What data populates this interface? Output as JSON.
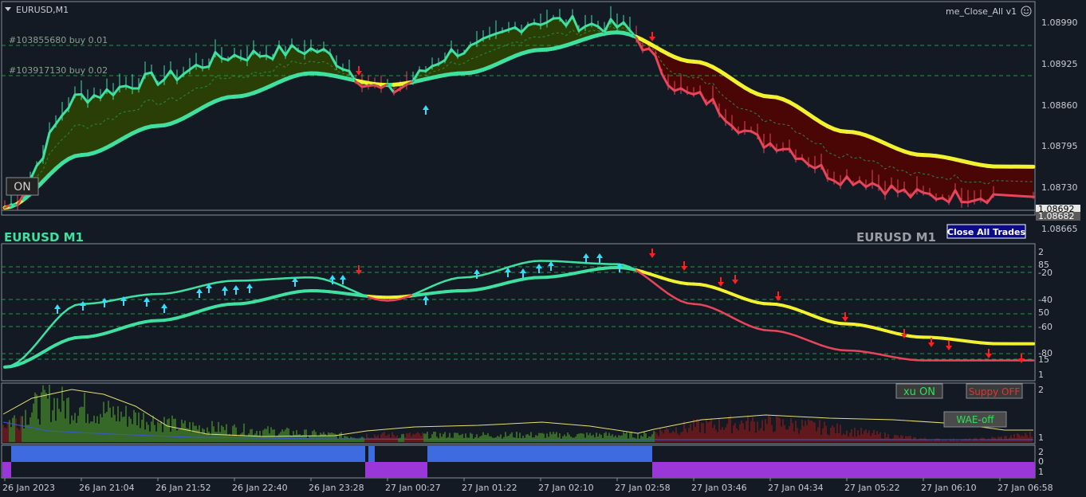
{
  "colors": {
    "background": "#131a24",
    "grid_dash": "#1f9a3f",
    "bull": "#3fe0a0",
    "bear": "#e8445a",
    "slow": "#f2f230",
    "ribbon_bull": "#2a3f06",
    "ribbon_bear": "#4a0505",
    "panel_border": "#8a8f96",
    "volume_bull": "#5ab52a",
    "volume_bear": "#b01818",
    "signal_line": "#e8e070",
    "strip_blue": "#3e6be0",
    "strip_purple": "#9b36d8"
  },
  "header": {
    "symbol": "EURUSD,M1",
    "indicator": "me_Close_All v1",
    "smiley_icon": "smiley-icon"
  },
  "orders": [
    {
      "label": "#103855680 buy 0.01",
      "price": 1.0895
    },
    {
      "label": "#103917130 buy 0.02",
      "price": 1.0891
    }
  ],
  "on_button": "ON",
  "watermark_left": "EURUSD M1",
  "watermark_right": "EURUSD M1",
  "close_all_button": "Close All Trades",
  "price_axis": {
    "ticks": [
      "1.08990",
      "1.08925",
      "1.08860",
      "1.08795",
      "1.08730",
      "1.08665"
    ],
    "current_labels": [
      "1.08692",
      "1.08682"
    ]
  },
  "osc_axis": {
    "ticks": [
      "2",
      "85",
      "-20",
      "-40",
      "50",
      "-60",
      "-80",
      "15",
      "1"
    ]
  },
  "vol_panel": {
    "xu_button": "xu ON",
    "suppy_button": "Suppy OFF",
    "wae_button": "WAE-off",
    "axis": [
      "2",
      "1"
    ]
  },
  "strip_axis": [
    "2",
    "0",
    "1"
  ],
  "time_axis": [
    "26 Jan 2023",
    "26 Jan 21:04",
    "26 Jan 21:52",
    "26 Jan 22:40",
    "26 Jan 23:28",
    "27 Jan 00:27",
    "27 Jan 01:22",
    "27 Jan 02:10",
    "27 Jan 02:58",
    "27 Jan 03:46",
    "27 Jan 04:34",
    "27 Jan 05:22",
    "27 Jan 06:10",
    "27 Jan 06:58"
  ],
  "chart_data": {
    "type": "line",
    "title": "EURUSD,M1",
    "ylim": [
      1.0865,
      1.0901
    ],
    "x": [
      "26 Jan 2023",
      "26 Jan 21:04",
      "26 Jan 21:52",
      "26 Jan 22:40",
      "26 Jan 23:28",
      "27 Jan 00:27",
      "27 Jan 01:22",
      "27 Jan 02:10",
      "27 Jan 02:58",
      "27 Jan 03:46",
      "27 Jan 04:34",
      "27 Jan 05:22",
      "27 Jan 06:10",
      "27 Jan 06:58"
    ],
    "series": [
      {
        "values": [
          1.0866,
          1.0885,
          1.0888,
          1.0892,
          1.0893,
          1.0886,
          1.0893,
          1.0898,
          1.0897,
          1.0885,
          1.0877,
          1.0871,
          1.0868,
          1.0868
        ]
      },
      {
        "values": [
          1.0866,
          1.0875,
          1.088,
          1.0885,
          1.0889,
          1.0887,
          1.0889,
          1.0893,
          1.0896,
          1.0891,
          1.0885,
          1.0879,
          1.0875,
          1.0873
        ]
      }
    ]
  },
  "strip": {
    "segments": [
      {
        "start": "26 Jan 2023",
        "end": "26 Jan 23:28",
        "state": "blue"
      },
      {
        "start": "26 Jan 23:28",
        "end": "27 Jan 00:27",
        "state": "purple"
      },
      {
        "start": "27 Jan 00:27",
        "end": "27 Jan 02:58",
        "state": "blue"
      },
      {
        "start": "27 Jan 02:58",
        "end": "27 Jan 06:58",
        "state": "purple"
      }
    ]
  }
}
